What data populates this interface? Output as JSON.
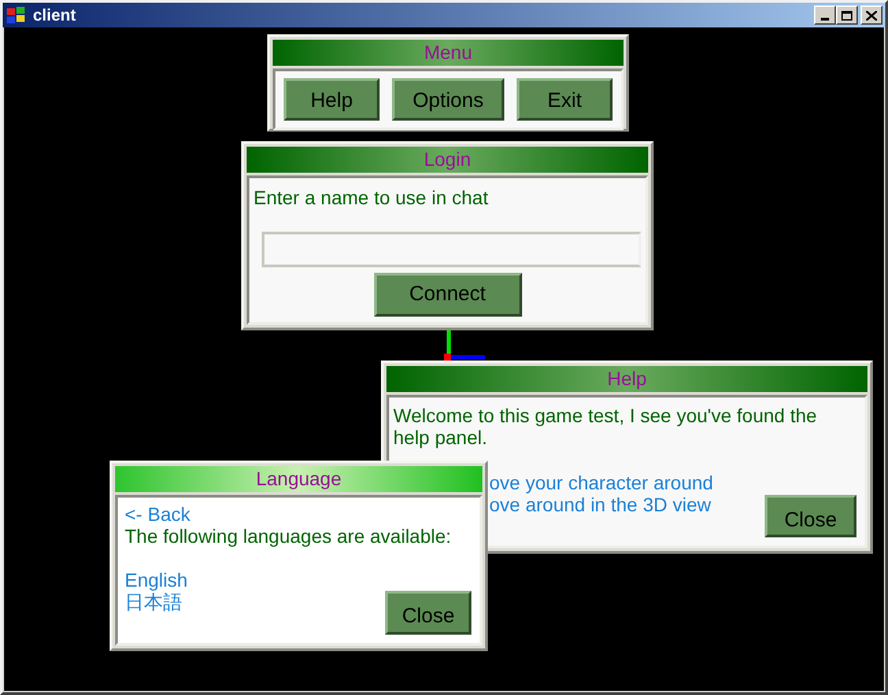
{
  "window": {
    "title": "client"
  },
  "panels": [
    {
      "kind": "menu",
      "title": "Menu",
      "active": false,
      "buttons": [
        "Help",
        "Options",
        "Exit"
      ]
    },
    {
      "kind": "login",
      "title": "Login",
      "active": false,
      "prompt": "Enter a name to use in chat",
      "connect": "Connect"
    },
    {
      "kind": "help",
      "title": "Help",
      "active": false,
      "text": "Welcome to this game test, I see you've found the help panel.",
      "links": [
        "ove your character around",
        "ove around in the 3D view"
      ],
      "close": "Close"
    },
    {
      "kind": "language",
      "title": "Language",
      "active": true,
      "back": "<- Back",
      "text": "The following languages are available:",
      "languages": [
        "English",
        "日本語"
      ],
      "close": "Close"
    }
  ]
}
